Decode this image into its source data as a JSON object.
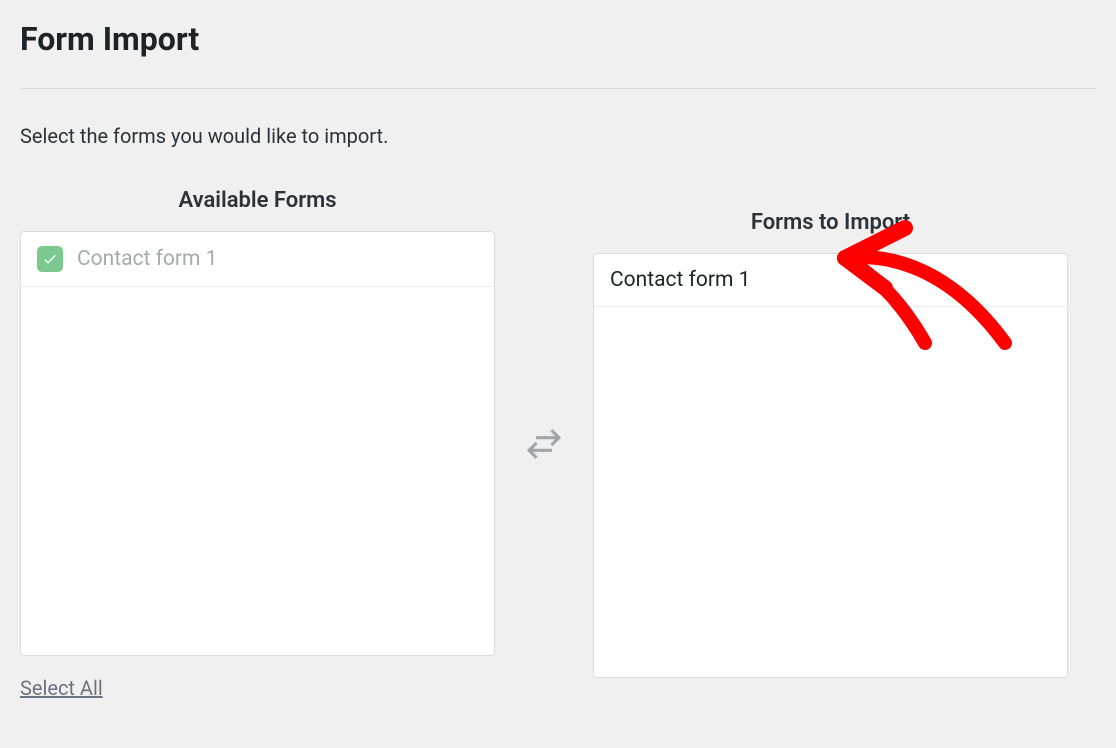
{
  "page": {
    "title": "Form Import",
    "instruction": "Select the forms you would like to import."
  },
  "available": {
    "header": "Available Forms",
    "items": [
      {
        "label": "Contact form 1",
        "checked": true
      }
    ],
    "select_all": "Select All"
  },
  "to_import": {
    "header": "Forms to Import",
    "items": [
      {
        "label": "Contact form 1"
      }
    ]
  },
  "annotation": {
    "color": "#ff0000"
  }
}
